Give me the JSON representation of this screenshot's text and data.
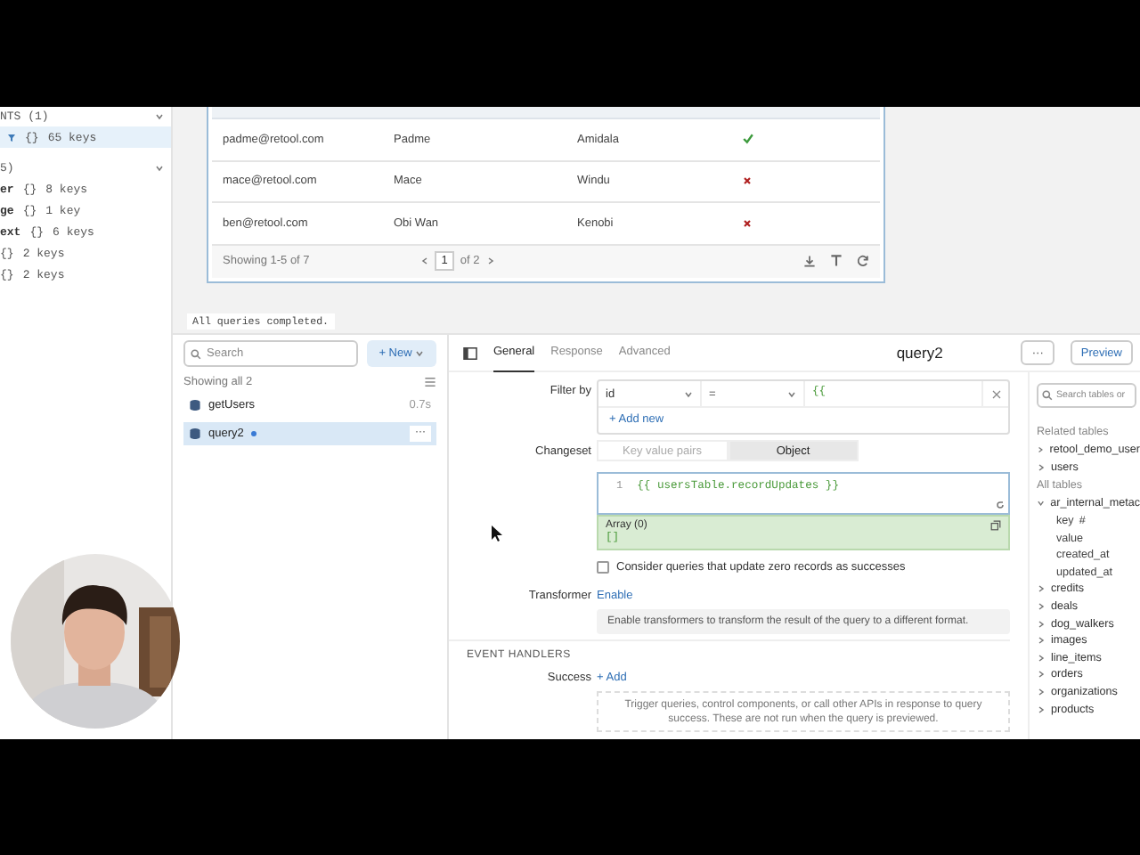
{
  "state_panel": {
    "sections": [
      {
        "title": "NTS (1)",
        "expanded": true,
        "items": [
          {
            "type": "{}",
            "summary": "65 keys",
            "selected": true
          }
        ]
      },
      {
        "title": "5)",
        "expanded": true,
        "items": [
          {
            "name": "er",
            "type": "{}",
            "summary": "8 keys",
            "selected": false
          },
          {
            "name": "ge",
            "type": "{}",
            "summary": "1 key",
            "selected": false
          },
          {
            "name": "ext",
            "type": "{}",
            "summary": "6 keys",
            "selected": false
          },
          {
            "type": "{}",
            "summary": "2 keys",
            "selected": false
          },
          {
            "type": "{}",
            "summary": "2 keys",
            "selected": false
          }
        ]
      }
    ]
  },
  "table": {
    "rows": [
      {
        "email": "padme@retool.com",
        "first_name": "Padme",
        "last_name": "Amidala",
        "verified": true
      },
      {
        "email": "mace@retool.com",
        "first_name": "Mace",
        "last_name": "Windu",
        "verified": false
      },
      {
        "email": "ben@retool.com",
        "first_name": "Obi Wan",
        "last_name": "Kenobi",
        "verified": false
      }
    ],
    "footer": {
      "showing": "Showing 1-5 of 7",
      "page": "1",
      "of_pages": "of 2"
    }
  },
  "status_message": "All queries completed.",
  "query_list": {
    "search": {
      "placeholder": "Search"
    },
    "new_button": "+ New",
    "count": "Showing all 2",
    "items": [
      {
        "name": "getUsers",
        "time": "0.7s",
        "unsaved": false,
        "selected": false
      },
      {
        "name": "query2",
        "unsaved": true,
        "selected": true
      }
    ]
  },
  "editor": {
    "tabs": [
      {
        "label": "General",
        "selected": true
      },
      {
        "label": "Response",
        "selected": false
      },
      {
        "label": "Advanced",
        "selected": false
      }
    ],
    "title": "query2",
    "more_button": "···",
    "preview_button": "Preview",
    "filter": {
      "label": "Filter by",
      "column": "id",
      "operator": "=",
      "value": "{{",
      "add_new": "+ Add new"
    },
    "changeset": {
      "label": "Changeset",
      "options": [
        {
          "label": "Key value pairs",
          "selected": false
        },
        {
          "label": "Object",
          "selected": true
        }
      ],
      "line_number": "1",
      "code": "{{ usersTable.recordUpdates }}",
      "result_type": "Array (0)",
      "result_value": "[]"
    },
    "zero_records": {
      "label": "Consider queries that update zero records as successes",
      "checked": false
    },
    "transformer": {
      "label": "Transformer",
      "link": "Enable",
      "hint": "Enable transformers to transform the result of the query to a different format."
    },
    "event_handlers": {
      "heading": "EVENT HANDLERS",
      "label": "Success",
      "link": "+ Add",
      "hint": "Trigger queries, control components, or call other APIs in response to query success. These are not run when the query is previewed."
    }
  },
  "schema": {
    "search": {
      "placeholder": "Search tables or"
    },
    "related_heading": "Related tables",
    "related": [
      {
        "name": "retool_demo_user",
        "expanded": false
      },
      {
        "name": "users",
        "expanded": false
      }
    ],
    "all_heading": "All tables",
    "tables": [
      {
        "name": "ar_internal_metac",
        "expanded": true,
        "children": [
          {
            "name": "key",
            "tag": "#"
          },
          {
            "name": "value"
          },
          {
            "name": "created_at"
          },
          {
            "name": "updated_at"
          }
        ]
      },
      {
        "name": "credits",
        "expanded": false
      },
      {
        "name": "deals",
        "expanded": false
      },
      {
        "name": "dog_walkers",
        "expanded": false
      },
      {
        "name": "images",
        "expanded": false
      },
      {
        "name": "line_items",
        "expanded": false
      },
      {
        "name": "orders",
        "expanded": false
      },
      {
        "name": "organizations",
        "expanded": false
      },
      {
        "name": "products",
        "expanded": false
      }
    ]
  }
}
